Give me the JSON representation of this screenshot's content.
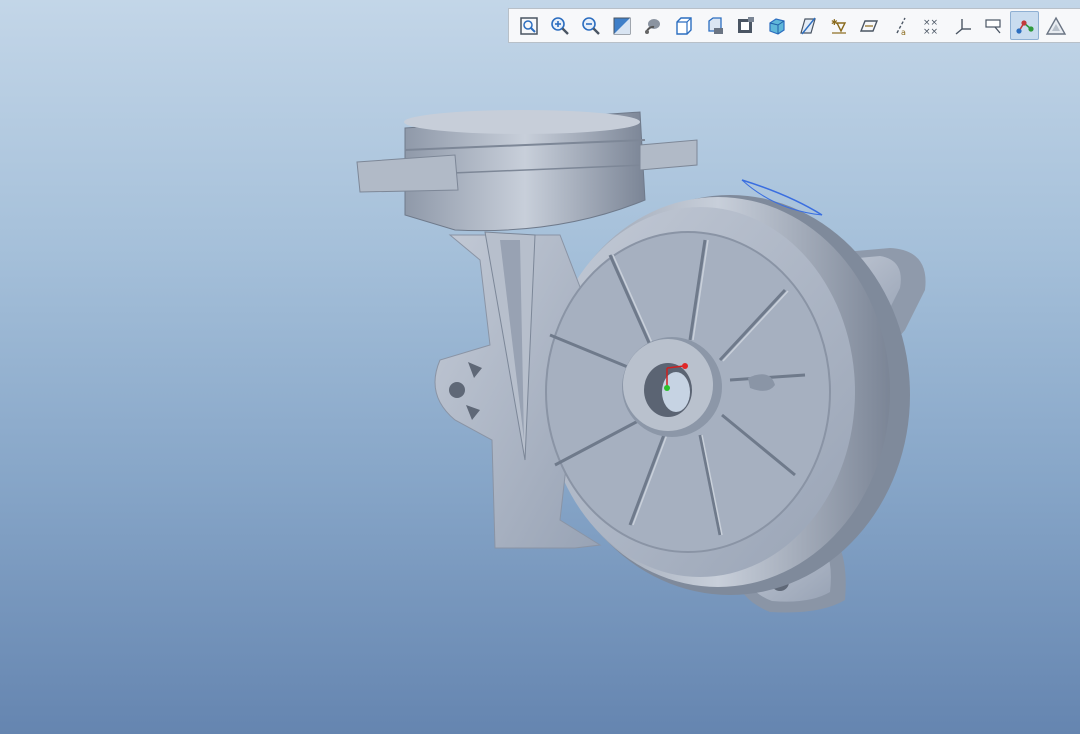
{
  "toolbar": {
    "buttons": [
      {
        "icon": "refit-icon",
        "active": false
      },
      {
        "icon": "zoom-in-icon",
        "active": false
      },
      {
        "icon": "zoom-out-icon",
        "active": false
      },
      {
        "icon": "repaint-icon",
        "active": false
      },
      {
        "icon": "spin-center-icon",
        "active": false
      },
      {
        "icon": "view-orientation-icon",
        "active": false
      },
      {
        "icon": "saved-views-icon",
        "active": false
      },
      {
        "icon": "view-manager-icon",
        "active": false
      },
      {
        "icon": "display-style-icon",
        "active": false
      },
      {
        "icon": "section-icon",
        "active": false
      },
      {
        "icon": "annotation-display-icon",
        "active": false
      },
      {
        "icon": "plane-display-icon",
        "active": false
      },
      {
        "icon": "axis-display-icon",
        "active": false
      },
      {
        "icon": "point-display-icon",
        "active": false
      },
      {
        "icon": "csys-display-icon",
        "active": false
      },
      {
        "icon": "annotation-toggle-icon",
        "active": false
      },
      {
        "icon": "spin-center-toggle-icon",
        "active": true
      },
      {
        "icon": "appearance-icon",
        "active": false
      }
    ]
  },
  "colors": {
    "model_body": "#a8b2c2",
    "model_shadow": "#7e8898",
    "model_highlight": "#d0d7e0",
    "selected_edge": "#3a6ee0"
  }
}
